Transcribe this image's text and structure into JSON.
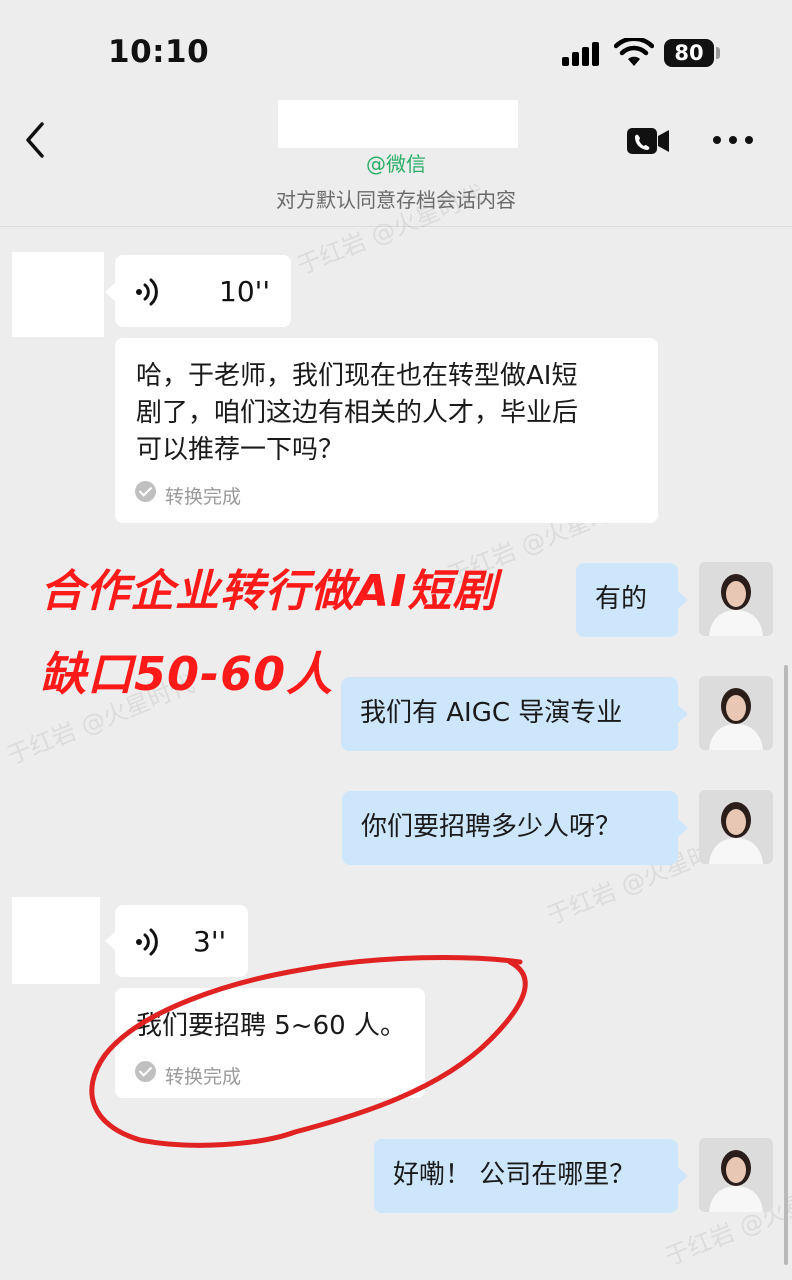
{
  "status_bar": {
    "time": "10:10",
    "battery": "80"
  },
  "header": {
    "wechat_tag": "@微信",
    "archive_note": "对方默认同意存档会话内容"
  },
  "messages": {
    "voice1_duration": "10''",
    "text1": "哈，于老师，我们现在也在转型做AI短剧了，咱们这边有相关的人才，毕业后可以推荐一下吗？",
    "text1_lines": [
      "哈，于老师，我们现在也在转型做AI短",
      "剧了，咱们这边有相关的人才，毕业后",
      "可以推荐一下吗？"
    ],
    "text1_status": "转换完成",
    "out1": "有的",
    "out2": "我们有 AIGC 导演专业",
    "out3": "你们要招聘多少人呀？",
    "voice2_duration": "3''",
    "text2": "我们要招聘 5~60 人。",
    "text2_status": "转换完成",
    "out4": "好嘞！ 公司在哪里？"
  },
  "overlay": {
    "line1": "合作企业转行做AI短剧",
    "line2": "缺口50-60人",
    "color": "#ff1a1a"
  },
  "colors": {
    "outgoing_bubble": "#cde6fb",
    "incoming_bubble": "#ffffff",
    "wechat_green": "#2aae67",
    "background": "#ededed"
  }
}
